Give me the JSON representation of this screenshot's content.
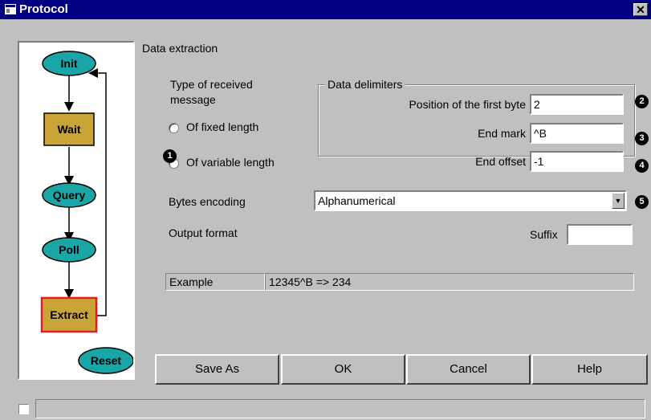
{
  "window": {
    "title": "Protocol",
    "close_symbol": "✕"
  },
  "flowchart": {
    "nodes": [
      "Init",
      "Wait",
      "Query",
      "Poll",
      "Extract",
      "Reset"
    ],
    "selected": "Extract"
  },
  "section_title": "Data extraction",
  "message_type": {
    "label_line1": "Type of received",
    "label_line2": "message",
    "fixed_label": "Of fixed length",
    "variable_label": "Of variable length"
  },
  "delimiters": {
    "title": "Data delimiters",
    "first_byte_label": "Position of the first byte",
    "first_byte_value": "2",
    "end_mark_label": "End mark",
    "end_mark_value": "^B",
    "end_offset_label": "End offset",
    "end_offset_value": "-1"
  },
  "encoding": {
    "label": "Bytes encoding",
    "value": "Alphanumerical",
    "arrow": "▼"
  },
  "output": {
    "label": "Output format",
    "suffix_label": "Suffix",
    "suffix_value": ""
  },
  "example": {
    "label": "Example",
    "value": "12345^B => 234"
  },
  "badges": [
    "1",
    "2",
    "3",
    "4",
    "5"
  ],
  "buttons": {
    "save_as": "Save As",
    "ok": "OK",
    "cancel": "Cancel",
    "help": "Help"
  },
  "status": {
    "text": ""
  },
  "colors": {
    "node_fill": "#1aa6a6",
    "box_fill": "#c9a436",
    "selected_border": "#e02020",
    "titlebar": "#000080"
  }
}
